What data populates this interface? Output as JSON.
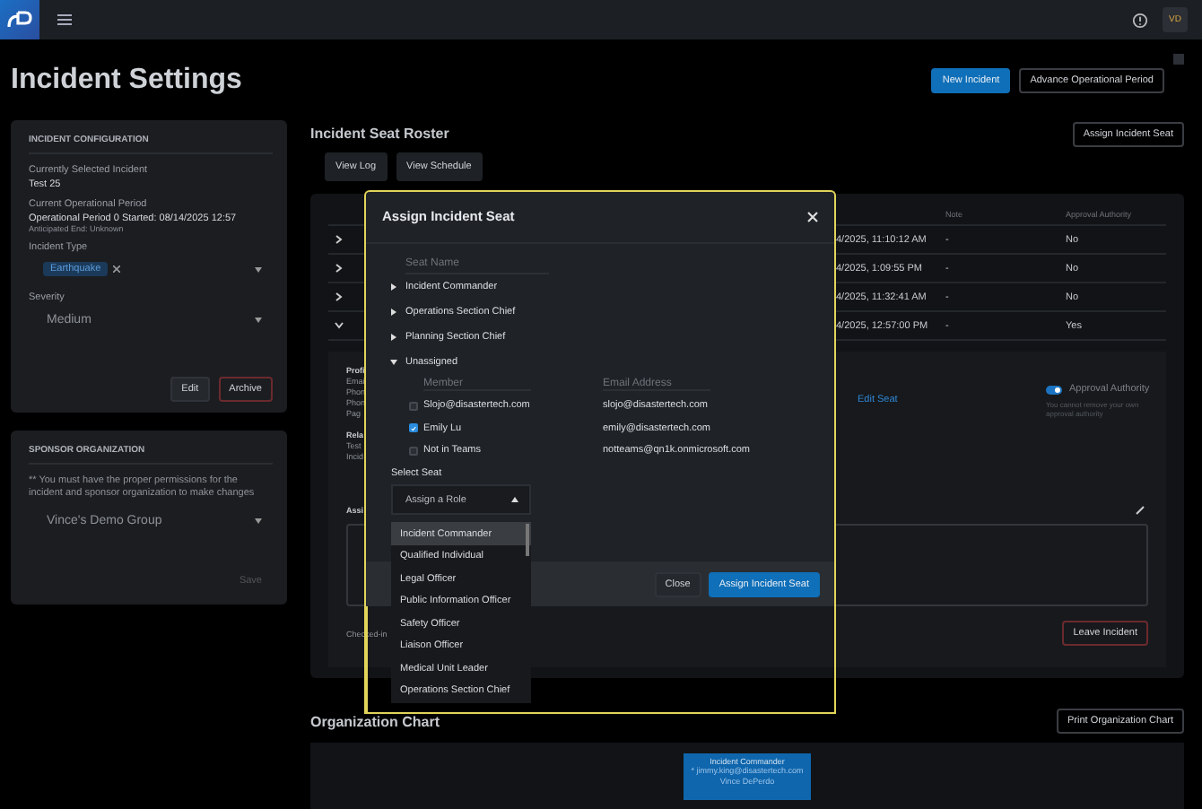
{
  "top_bar": {
    "avatar": "VD"
  },
  "page_title": "Incident Settings",
  "header_buttons": [
    {
      "label": "New Incident",
      "kind": "primary"
    },
    {
      "label": "Advance Operational Period",
      "kind": "outline"
    }
  ],
  "incident_configuration": {
    "title": "INCIDENT CONFIGURATION",
    "fields": [
      {
        "label": "Currently Selected Incident",
        "value": "Test 25"
      },
      {
        "label": "Current Operational Period",
        "value": "Operational Period 0 Started: 08/14/2025 12:57",
        "note": "Anticipated End: Unknown"
      }
    ],
    "incident_type": {
      "label": "Incident Type",
      "tags": [
        "Earthquake"
      ]
    },
    "severity": {
      "label": "Severity",
      "value": "Medium"
    },
    "buttons": [
      {
        "label": "Edit",
        "kind": "default"
      },
      {
        "label": "Archive",
        "kind": "danger"
      }
    ]
  },
  "sponsor_organization": {
    "title": "SPONSOR ORGANIZATION",
    "notice": "** You must have the proper permissions for the incident and sponsor organization to make changes",
    "value": "Vince's Demo Group",
    "save": {
      "label": "Save",
      "disabled": true
    }
  },
  "roster": {
    "title": "Incident Seat Roster",
    "assign_button": "Assign Incident Seat",
    "tabs": [
      "View Log",
      "View Schedule"
    ],
    "columns": [
      "Note",
      "Approval Authority"
    ],
    "rows": [
      {
        "expanded": false,
        "time": "4/2025, 11:10:12 AM",
        "note": "-",
        "approval": "No"
      },
      {
        "expanded": false,
        "time": "4/2025, 1:09:55 PM",
        "note": "-",
        "approval": "No"
      },
      {
        "expanded": false,
        "time": "4/2025, 11:32:41 AM",
        "note": "-",
        "approval": "No"
      },
      {
        "expanded": true,
        "time": "4/2025, 12:57:00 PM",
        "note": "-",
        "approval": "Yes"
      }
    ],
    "detail": {
      "labels": [
        "Profi",
        "Emai",
        "Phon",
        "Phon",
        "Pag"
      ],
      "labels_2": [
        "Rela",
        "Test",
        "Incid"
      ],
      "assign_label": "Assi",
      "edit_link": "Edit Seat",
      "approval_toggle": {
        "label": "Approval Authority",
        "on": true,
        "hint": "You cannot remove your own approval authority"
      },
      "checked_in": "Checked-in",
      "leave_button": "Leave Incident"
    }
  },
  "org_chart": {
    "title": "Organization Chart",
    "print_button": "Print Organization Chart",
    "nodes": [
      {
        "title": "Incident Commander",
        "lines": [
          "* jimmy.king@disastertech.com",
          "Vince DePerdo"
        ]
      }
    ]
  },
  "modal": {
    "title": "Assign Incident Seat",
    "seat_header": "Seat Name",
    "seats": [
      {
        "name": "Incident Commander",
        "expanded": false
      },
      {
        "name": "Operations Section Chief",
        "expanded": false
      },
      {
        "name": "Planning Section Chief",
        "expanded": false
      },
      {
        "name": "Unassigned",
        "expanded": true
      }
    ],
    "member_columns": [
      "Member",
      "Email Address"
    ],
    "members": [
      {
        "name": "Slojo@disastertech.com",
        "email": "slojo@disastertech.com",
        "checked": false
      },
      {
        "name": "Emily Lu",
        "email": "emily@disastertech.com",
        "checked": true
      },
      {
        "name": "Not in Teams",
        "email": "notteams@qn1k.onmicrosoft.com",
        "checked": false
      }
    ],
    "select_label": "Select Seat",
    "select_placeholder": "Assign a Role",
    "options": [
      {
        "label": "Incident Commander",
        "selected": true
      },
      {
        "label": "Qualified Individual",
        "selected": false
      },
      {
        "label": "Legal Officer",
        "selected": false
      },
      {
        "label": "Public Information Officer",
        "selected": false
      },
      {
        "label": "Safety Officer",
        "selected": false
      },
      {
        "label": "Liaison Officer",
        "selected": false
      },
      {
        "label": "Medical Unit Leader",
        "selected": false
      },
      {
        "label": "Operations Section Chief",
        "selected": false
      }
    ],
    "buttons": [
      {
        "label": "Close",
        "kind": "default"
      },
      {
        "label": "Assign Incident Seat",
        "kind": "primary"
      }
    ]
  }
}
